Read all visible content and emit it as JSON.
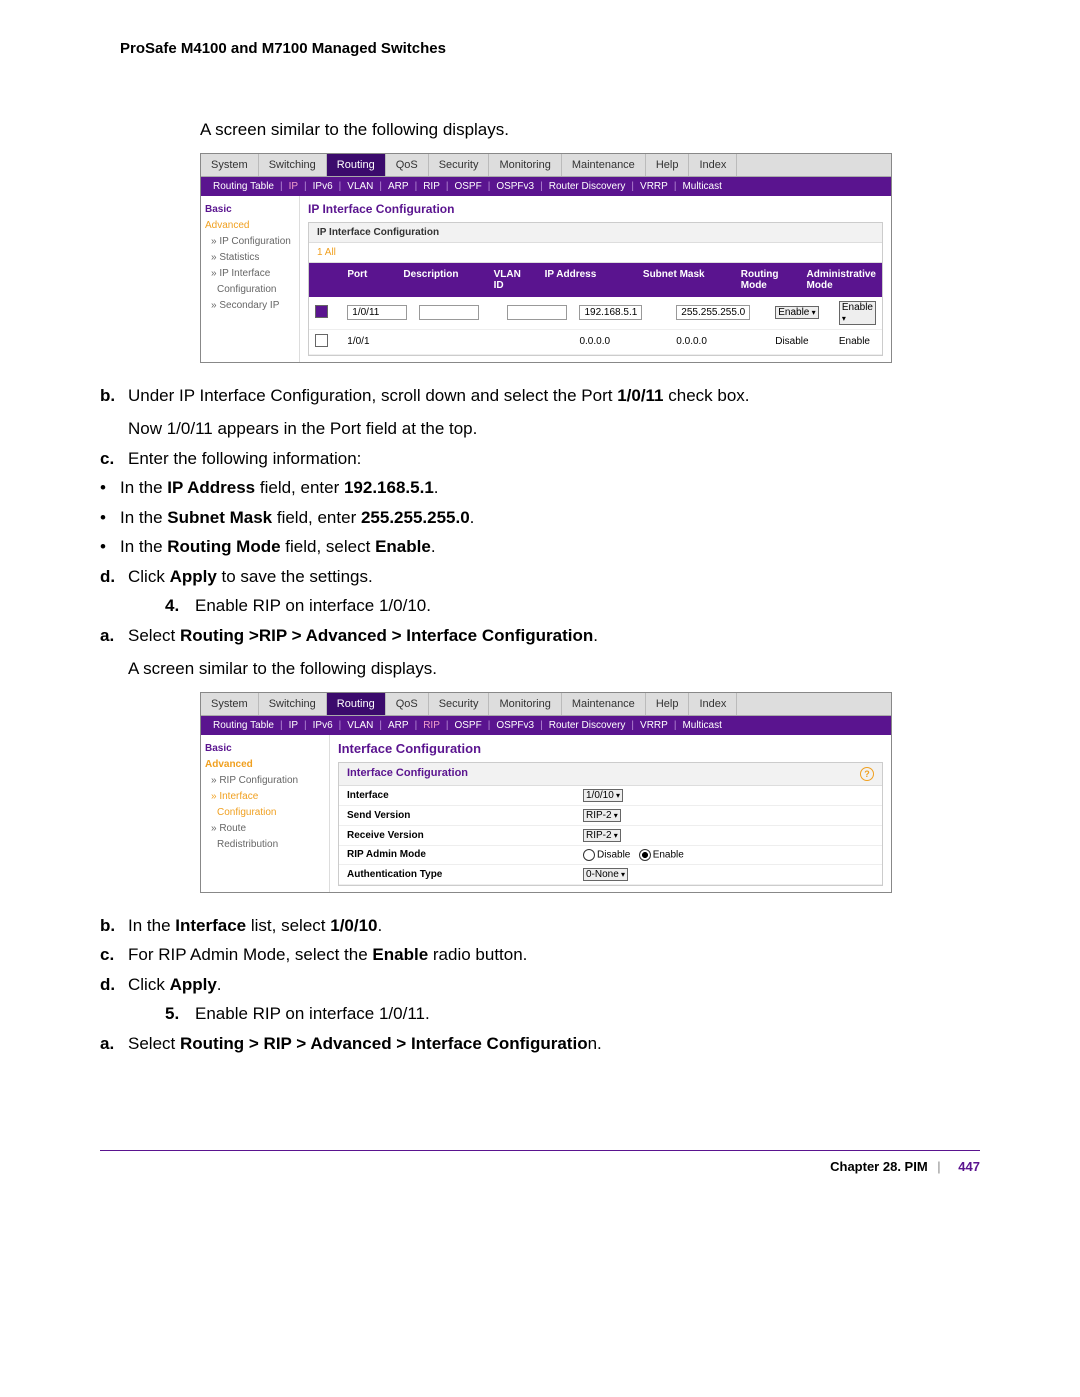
{
  "header": "ProSafe M4100 and M7100 Managed Switches",
  "intro1": "A screen similar to the following displays.",
  "shot1": {
    "tabs": [
      "System",
      "Switching",
      "Routing",
      "QoS",
      "Security",
      "Monitoring",
      "Maintenance",
      "Help",
      "Index"
    ],
    "subtabs": [
      "Routing Table",
      "IP",
      "IPv6",
      "VLAN",
      "ARP",
      "RIP",
      "OSPF",
      "OSPFv3",
      "Router Discovery",
      "VRRP",
      "Multicast"
    ],
    "sidebar": {
      "basic": "Basic",
      "advanced": "Advanced",
      "ipconf": "» IP Configuration",
      "stats": "» Statistics",
      "ipif": "» IP Interface",
      "ipifc": "Configuration",
      "secip": "» Secondary IP"
    },
    "main_title": "IP Interface Configuration",
    "bar_title": "IP Interface Configuration",
    "all": "1  All",
    "th": [
      "",
      "Port",
      "Description",
      "VLAN ID",
      "IP Address",
      "Subnet Mask",
      "Routing Mode",
      "Administrative Mode"
    ],
    "r1": {
      "port": "1/0/11",
      "ip": "192.168.5.1",
      "mask": "255.255.255.0",
      "rmode": "Enable",
      "amode": "Enable"
    },
    "r2": {
      "port": "1/0/1",
      "ip": "0.0.0.0",
      "mask": "0.0.0.0",
      "rmode": "Disable",
      "amode": "Enable"
    }
  },
  "step_b_pre": "Under IP Interface Configuration, scroll down and select the Port ",
  "step_b_bold": "1/0/11",
  "step_b_post": " check box.",
  "step_b_line2": "Now 1/0/11 appears in the Port field at the top.",
  "step_c": "Enter the following information:",
  "c_b1_pre": "In the ",
  "c_b1_bold1": "IP Address",
  "c_b1_mid": " field, enter ",
  "c_b1_bold2": "192.168.5.1",
  "c_b1_post": ".",
  "c_b2_pre": "In the ",
  "c_b2_bold1": "Subnet Mask",
  "c_b2_mid": " field, enter ",
  "c_b2_bold2": "255.255.255.0",
  "c_b2_post": ".",
  "c_b3_pre": "In the ",
  "c_b3_bold1": "Routing Mode",
  "c_b3_mid": " field, select ",
  "c_b3_bold2": "Enable",
  "c_b3_post": ".",
  "step_d_pre": "Click ",
  "step_d_bold": "Apply",
  "step_d_post": " to save the settings.",
  "step4": "Enable RIP on interface 1/0/10.",
  "step4a_pre": "Select ",
  "step4a_bold": "Routing >RIP > Advanced > Interface Configuration",
  "step4a_post": ".",
  "step4a_line2": "A screen similar to the following displays.",
  "shot2": {
    "tabs": [
      "System",
      "Switching",
      "Routing",
      "QoS",
      "Security",
      "Monitoring",
      "Maintenance",
      "Help",
      "Index"
    ],
    "subtabs": [
      "Routing Table",
      "IP",
      "IPv6",
      "VLAN",
      "ARP",
      "RIP",
      "OSPF",
      "OSPFv3",
      "Router Discovery",
      "VRRP",
      "Multicast"
    ],
    "sidebar": {
      "basic": "Basic",
      "advanced": "Advanced",
      "ripconf": "» RIP Configuration",
      "ifconf": "» Interface",
      "ifconf2": "Configuration",
      "route": "» Route",
      "redis": "Redistribution"
    },
    "main_title": "Interface Configuration",
    "bar_title": "Interface Configuration",
    "rows": {
      "iface_l": "Interface",
      "iface_v": "1/0/10",
      "sv_l": "Send Version",
      "sv_v": "RIP-2",
      "rv_l": "Receive Version",
      "rv_v": "RIP-2",
      "am_l": "RIP Admin Mode",
      "am_d": "Disable",
      "am_e": "Enable",
      "at_l": "Authentication Type",
      "at_v": "0-None"
    }
  },
  "s4b_pre": "In the ",
  "s4b_bold1": "Interface",
  "s4b_mid": " list, select ",
  "s4b_bold2": "1/0/10",
  "s4b_post": ".",
  "s4c_pre": "For RIP Admin Mode, select the ",
  "s4c_bold": "Enable",
  "s4c_post": " radio button.",
  "s4d_pre": "Click ",
  "s4d_bold": "Apply",
  "s4d_post": ".",
  "step5": "Enable RIP on interface 1/0/11.",
  "step5a_pre": "Select ",
  "step5a_bold": "Routing > RIP > Advanced > Interface Configuratio",
  "step5a_post": "n.",
  "footer": {
    "chapter": "Chapter 28.  PIM",
    "page": "447"
  }
}
